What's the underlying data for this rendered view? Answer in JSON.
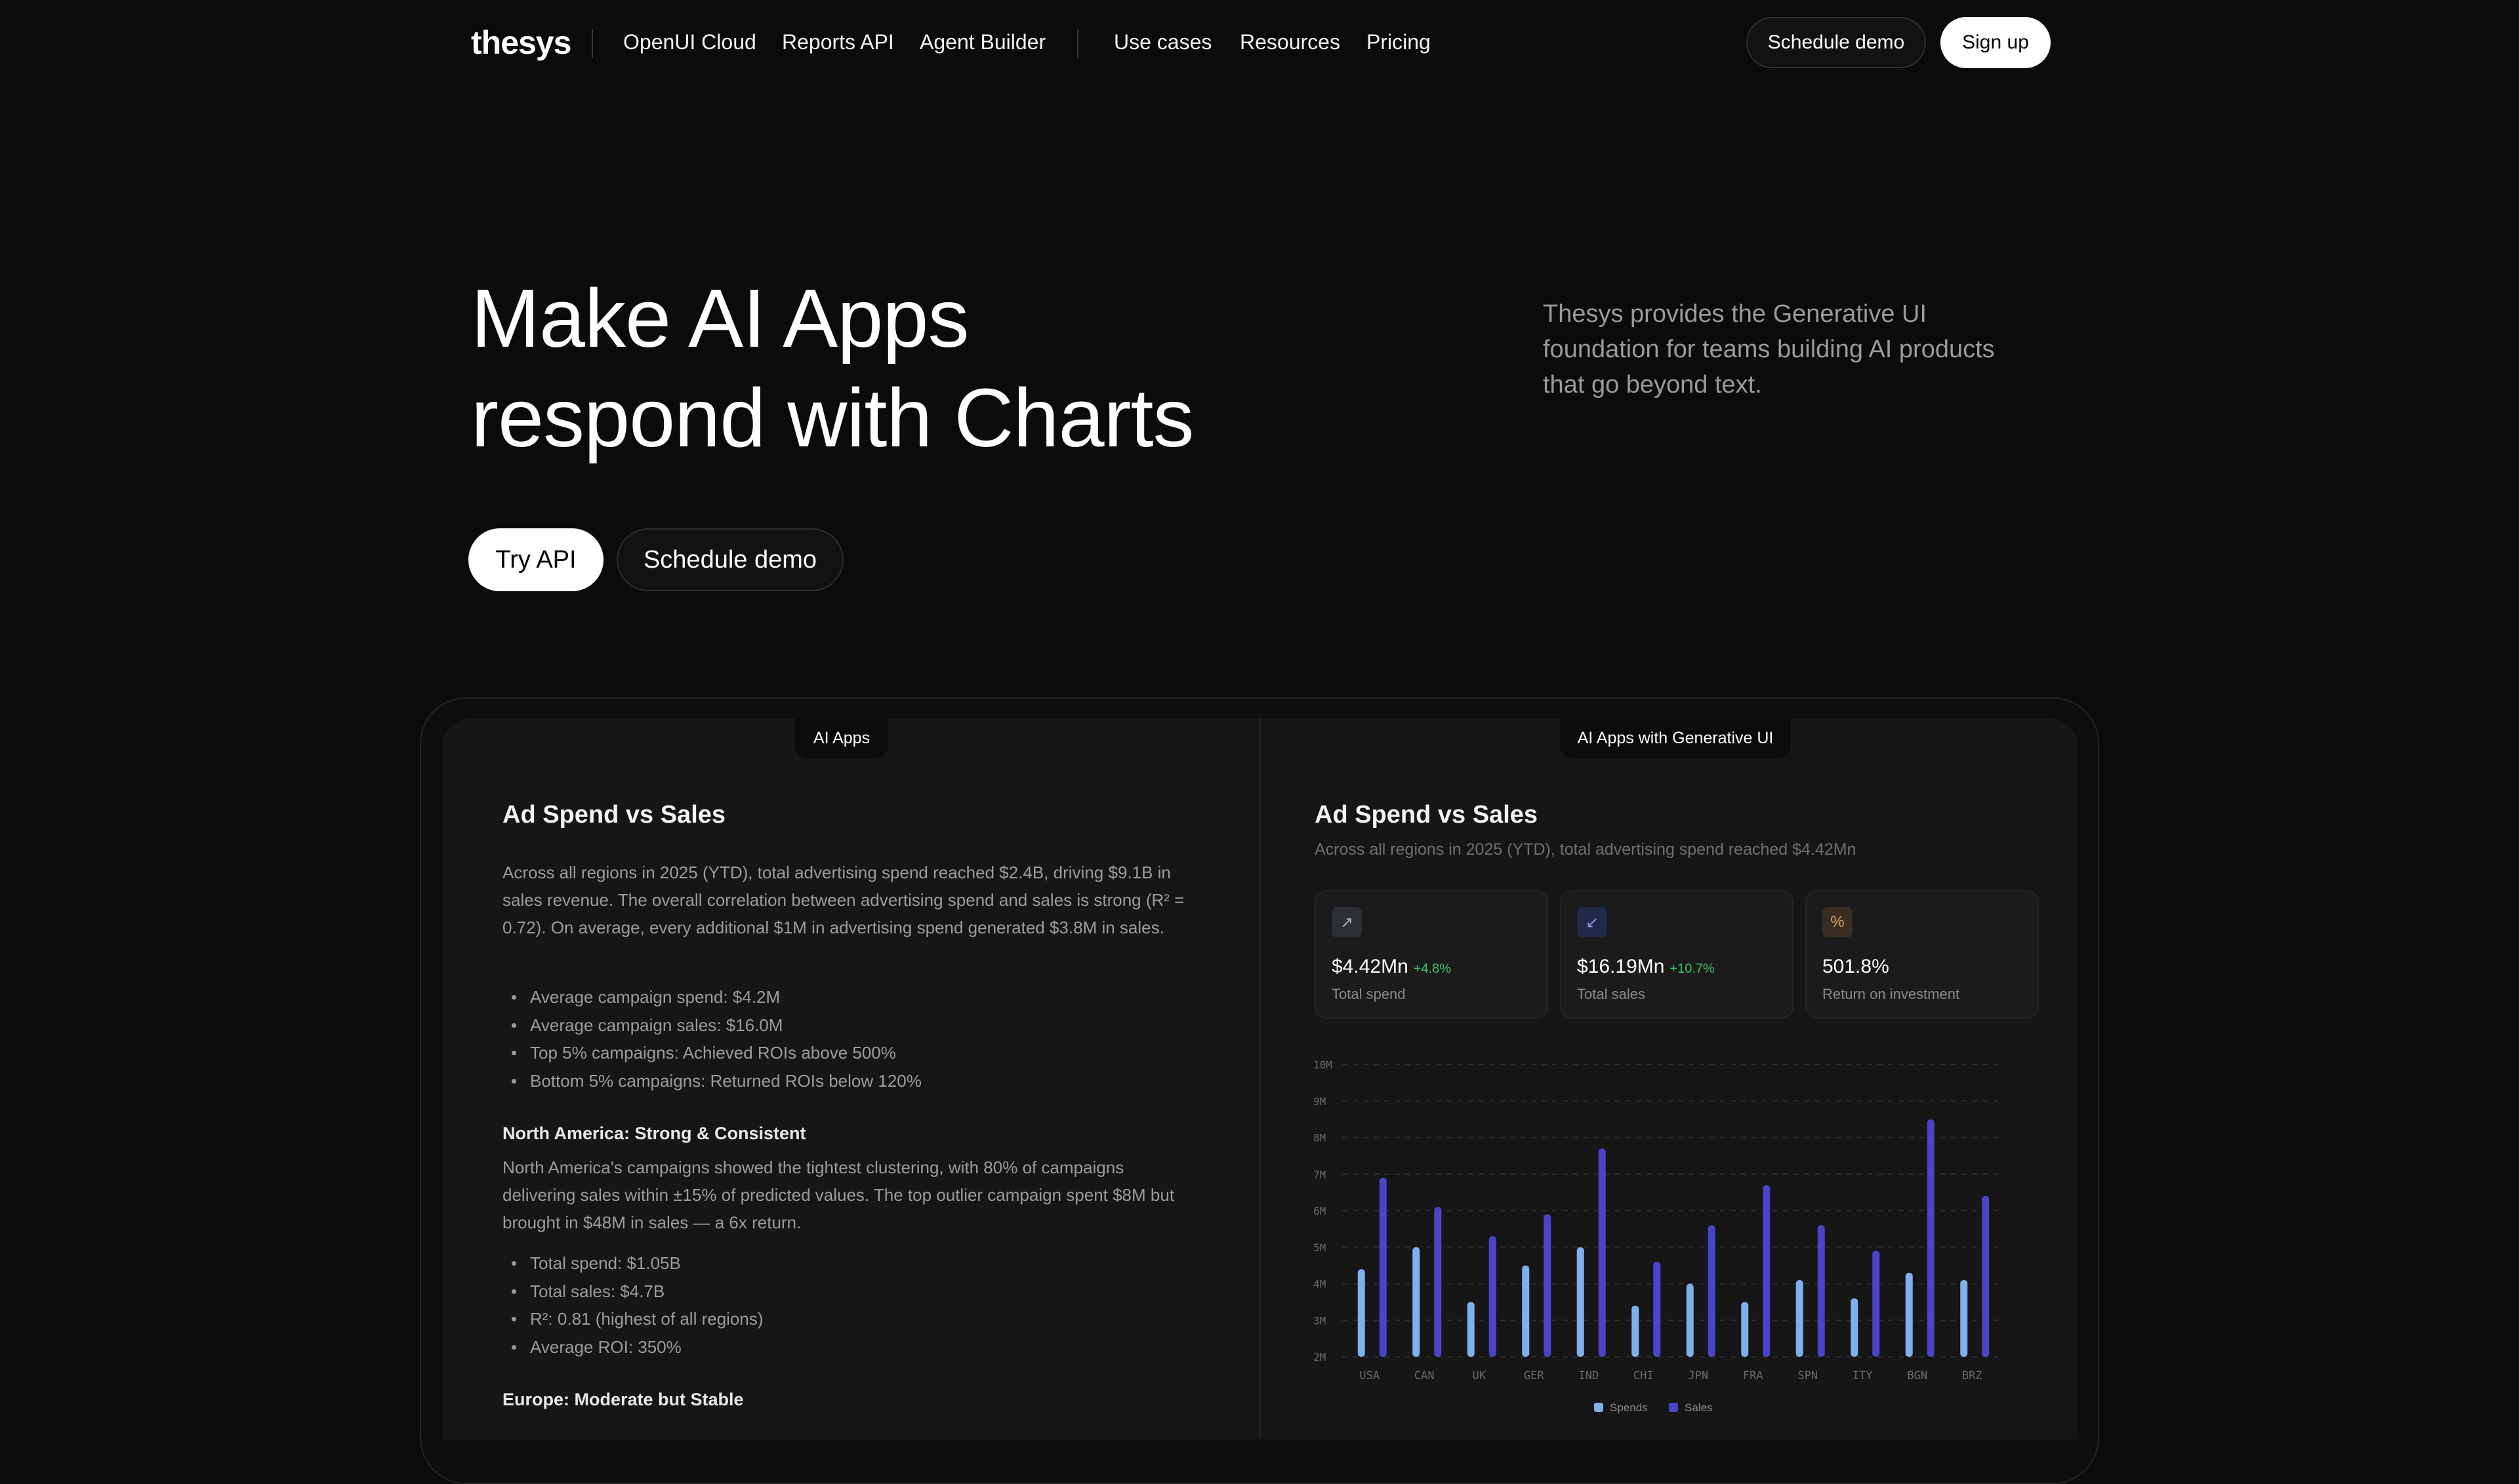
{
  "nav": {
    "logo": "thesys",
    "links": [
      "OpenUI Cloud",
      "Reports API",
      "Agent Builder",
      "Use cases",
      "Resources",
      "Pricing"
    ],
    "schedule_demo": "Schedule demo",
    "sign_up": "Sign up"
  },
  "hero": {
    "title_line1": "Make AI Apps",
    "title_line2": "respond with Charts",
    "subtitle": "Thesys provides the Generative UI foundation for teams building AI products that go beyond text.",
    "try_api": "Try API",
    "schedule_demo": "Schedule demo"
  },
  "demo": {
    "left_tab": "AI Apps",
    "right_tab": "AI Apps with Generative UI",
    "left": {
      "title": "Ad Spend vs Sales",
      "intro": "Across all regions in 2025 (YTD), total advertising spend reached $2.4B, driving $9.1B in sales revenue. The overall correlation between advertising spend and sales is strong (R² = 0.72). On average, every additional $1M in advertising spend generated $3.8M in sales.",
      "bullets1": [
        "Average campaign spend: $4.2M",
        "Average campaign sales: $16.0M",
        "Top 5% campaigns: Achieved ROIs above 500%",
        "Bottom 5% campaigns: Returned ROIs below 120%"
      ],
      "na_heading": "North America: Strong & Consistent",
      "na_para": "North America's campaigns showed the tightest clustering, with 80% of campaigns delivering sales within ±15% of predicted values. The top outlier campaign spent $8M but brought in $48M in sales — a 6x return.",
      "bullets2": [
        "Total spend: $1.05B",
        "Total sales: $4.7B",
        "R²: 0.81 (highest of all regions)",
        "Average ROI: 350%"
      ],
      "eu_heading": "Europe: Moderate but Stable"
    },
    "right": {
      "title": "Ad Spend vs Sales",
      "subtitle": "Across all regions in 2025 (YTD), total advertising spend reached $4.42Mn",
      "cards": [
        {
          "icon": "arrow-up-right-icon",
          "glyph": "↗",
          "value": "$4.42Mn",
          "delta": "+4.8%",
          "label": "Total spend",
          "icon_bg": "#2c2f33",
          "icon_color": "#a8b0b8"
        },
        {
          "icon": "arrow-down-left-icon",
          "glyph": "↙",
          "value": "$16.19Mn",
          "delta": "+10.7%",
          "label": "Total sales",
          "icon_bg": "#22284a",
          "icon_color": "#8a94e6"
        },
        {
          "icon": "percent-icon",
          "glyph": "%",
          "value": "501.8%",
          "delta": "",
          "label": "Return on investment",
          "icon_bg": "#3a2e22",
          "icon_color": "#d8a36a"
        }
      ]
    }
  },
  "chart_data": {
    "type": "bar",
    "categories": [
      "USA",
      "CAN",
      "UK",
      "GER",
      "IND",
      "CHI",
      "JPN",
      "FRA",
      "SPN",
      "ITY",
      "BGN",
      "BRZ"
    ],
    "series": [
      {
        "name": "Spends",
        "color": "#7fb0ee",
        "values": [
          4.4,
          5.0,
          3.5,
          4.5,
          5.0,
          3.4,
          4.0,
          3.5,
          4.1,
          3.6,
          4.3,
          4.1
        ]
      },
      {
        "name": "Sales",
        "color": "#4a44c8",
        "values": [
          6.9,
          6.1,
          5.3,
          5.9,
          7.7,
          4.6,
          5.6,
          6.7,
          5.6,
          4.9,
          8.5,
          6.4
        ]
      }
    ],
    "y_ticks": [
      "2M",
      "3M",
      "4M",
      "5M",
      "6M",
      "7M",
      "8M",
      "9M",
      "10M"
    ],
    "ylim": [
      2,
      10
    ],
    "grid": true,
    "legend": "bottom"
  }
}
